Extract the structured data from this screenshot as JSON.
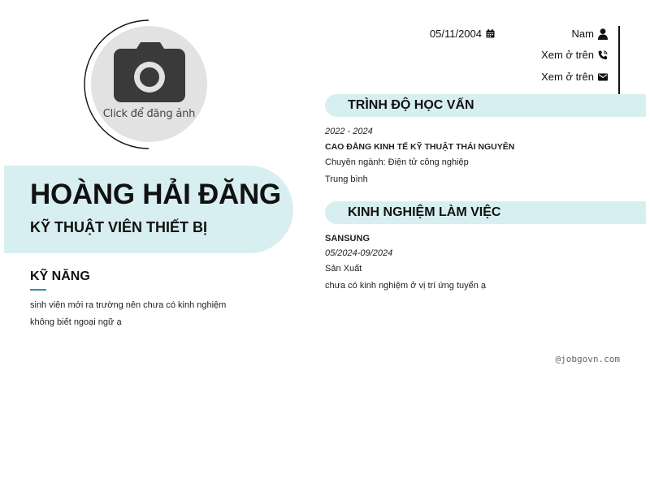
{
  "avatar": {
    "caption": "Click để đăng ảnh",
    "icon": "camera-icon",
    "arc_color": "#111111",
    "placeholder_color": "#e2e2e2",
    "icon_color": "#3a3a3a"
  },
  "profile": {
    "name": "HOÀNG HẢI ĐĂNG",
    "title": "KỸ THUẬT VIÊN THIẾT BỊ"
  },
  "contact": {
    "dob": {
      "value": "05/11/2004",
      "icon": "calendar-icon"
    },
    "gender": {
      "value": "Nam",
      "icon": "user-icon"
    },
    "phone": {
      "value": "Xem ở trên",
      "icon": "phone-icon"
    },
    "email": {
      "value": "Xem ở trên",
      "icon": "envelope-icon"
    }
  },
  "skills": {
    "heading": "KỸ NĂNG",
    "items": [
      "sinh viên mới ra trường nên chưa có kinh nghiệm",
      "không biết ngoại ngữ ạ"
    ]
  },
  "education": {
    "heading": "TRÌNH ĐỘ HỌC VẤN",
    "period": "2022 - 2024",
    "school": "CAO ĐẲNG KINH TẾ KỸ THUẬT THÁI NGUYÊN",
    "major": "Chuyên ngành: Điện tử công nghiệp",
    "grade": "Trung bình"
  },
  "experience": {
    "heading": "KINH NGHIỆM LÀM VIỆC",
    "company": "SANSUNG",
    "period": "05/2024-09/2024",
    "position": "Sản Xuất",
    "description": "chưa có kinh nghiệm ở vị trí ứng tuyển ạ"
  },
  "watermark": "@jobgovn.com",
  "colors": {
    "accent_background": "#d8eff1",
    "accent_line": "#2e8fb3",
    "text": "#111111"
  }
}
